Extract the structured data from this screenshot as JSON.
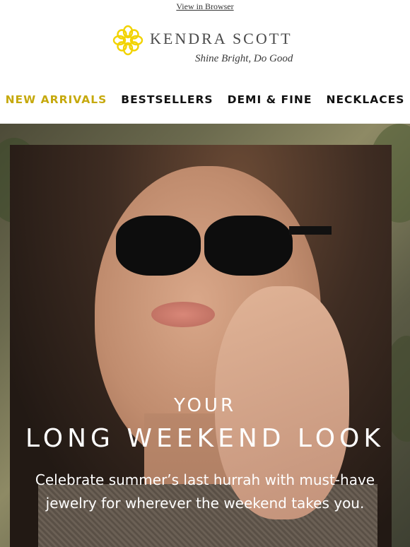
{
  "header": {
    "view_in_browser": "View in Browser"
  },
  "logo": {
    "brand": "KENDRA SCOTT",
    "tagline": "Shine Bright, Do Good",
    "mark_color": "#f2d300"
  },
  "nav": {
    "items": [
      {
        "label": "NEW ARRIVALS",
        "accent": true
      },
      {
        "label": "BESTSELLERS"
      },
      {
        "label": "DEMI & FINE"
      },
      {
        "label": "NECKLACES"
      }
    ],
    "accent_color": "#c6a90d"
  },
  "hero": {
    "eyebrow": "YOUR",
    "headline": "LONG WEEKEND LOOK",
    "copy": "Celebrate summer’s last hurrah with must-have jewelry for wherever the weekend takes you."
  }
}
